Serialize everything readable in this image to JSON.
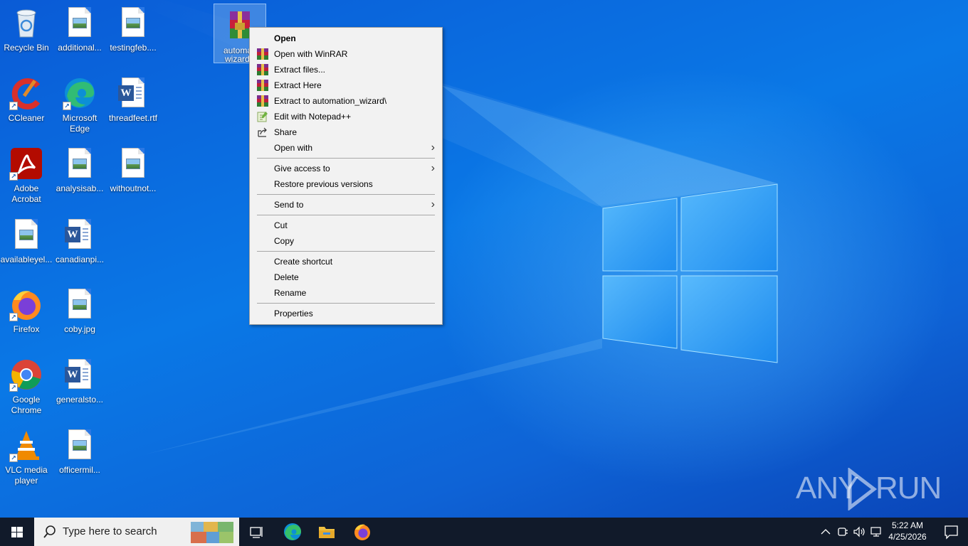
{
  "desktop": {
    "icons": [
      {
        "id": "recycle-bin",
        "label": "Recycle Bin"
      },
      {
        "id": "additional",
        "label": "additional..."
      },
      {
        "id": "testingfeb",
        "label": "testingfeb...."
      },
      {
        "id": "automation-wizard",
        "label": "automati\nwizard.r",
        "selected": true
      },
      {
        "id": "ccleaner",
        "label": "CCleaner"
      },
      {
        "id": "microsoft-edge",
        "label": "Microsoft Edge"
      },
      {
        "id": "threadfeet",
        "label": "threadfeet.rtf"
      },
      {
        "id": "adobe-acrobat",
        "label": "Adobe Acrobat"
      },
      {
        "id": "analysisab",
        "label": "analysisab..."
      },
      {
        "id": "withoutnot",
        "label": "withoutnot..."
      },
      {
        "id": "availableyel",
        "label": "availableyel..."
      },
      {
        "id": "canadianpi",
        "label": "canadianpi..."
      },
      {
        "id": "firefox",
        "label": "Firefox"
      },
      {
        "id": "coby",
        "label": "coby.jpg"
      },
      {
        "id": "google-chrome",
        "label": "Google Chrome"
      },
      {
        "id": "generalsto",
        "label": "generalsto..."
      },
      {
        "id": "vlc",
        "label": "VLC media player"
      },
      {
        "id": "officermil",
        "label": "officermil..."
      }
    ],
    "selected_icon_label_line1": "automati",
    "selected_icon_label_line2": "wizard.r"
  },
  "context_menu": {
    "items": [
      {
        "label": "Open",
        "bold": true
      },
      {
        "label": "Open with WinRAR",
        "icon": "winrar-icon"
      },
      {
        "label": "Extract files...",
        "icon": "winrar-icon"
      },
      {
        "label": "Extract Here",
        "icon": "winrar-icon"
      },
      {
        "label": "Extract to automation_wizard\\",
        "icon": "winrar-icon"
      },
      {
        "label": "Edit with Notepad++",
        "icon": "notepadpp-icon"
      },
      {
        "label": "Share",
        "icon": "share-icon"
      },
      {
        "label": "Open with",
        "submenu": true
      },
      {
        "label": "Give access to",
        "submenu": true
      },
      {
        "label": "Restore previous versions"
      },
      {
        "label": "Send to",
        "submenu": true
      },
      {
        "label": "Cut"
      },
      {
        "label": "Copy"
      },
      {
        "label": "Create shortcut"
      },
      {
        "label": "Delete"
      },
      {
        "label": "Rename"
      },
      {
        "label": "Properties"
      }
    ]
  },
  "taskbar": {
    "search_placeholder": "Type here to search",
    "clock_time": "5:22 AM",
    "clock_date": "4/25/2026"
  },
  "watermark": {
    "left": "ANY",
    "right": "RUN"
  },
  "colors": {
    "taskbar": "#111a2a",
    "desktop": "#0a78e6",
    "menu": "#f2f2f2"
  }
}
